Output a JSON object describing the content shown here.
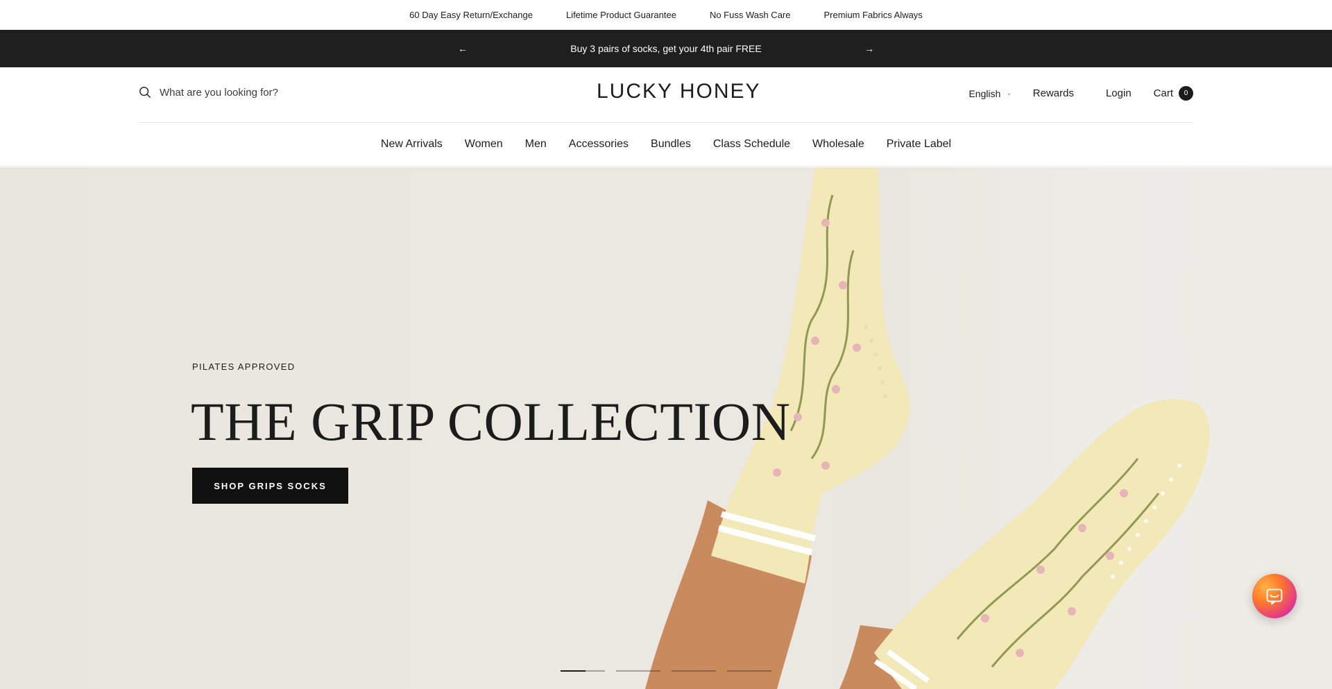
{
  "usp_bar": {
    "items": [
      "60 Day Easy Return/Exchange",
      "Lifetime Product Guarantee",
      "No Fuss Wash Care",
      "Premium Fabrics Always"
    ]
  },
  "announcement": {
    "text": "Buy 3 pairs of socks, get your 4th pair FREE",
    "prev_icon": "arrow-left-icon",
    "next_icon": "arrow-right-icon"
  },
  "header": {
    "search_placeholder": "What are you looking for?",
    "logo_text": "LUCKY HONEY",
    "language": "English",
    "rewards_label": "Rewards",
    "login_label": "Login",
    "cart_label": "Cart",
    "cart_count": "0"
  },
  "nav": {
    "items": [
      "New Arrivals",
      "Women",
      "Men",
      "Accessories",
      "Bundles",
      "Class Schedule",
      "Wholesale",
      "Private Label"
    ]
  },
  "hero": {
    "kicker": "PILATES APPROVED",
    "headline": "THE GRIP COLLECTION",
    "cta_label": "SHOP GRIPS SOCKS",
    "slides_total": 4,
    "active_slide": 1
  },
  "colors": {
    "announcement_bg": "#1f1f1f",
    "cta_bg": "#111111",
    "hero_bg": "#e9e6df",
    "sock_cream": "#f2e8b8",
    "skin": "#c98a5e"
  }
}
